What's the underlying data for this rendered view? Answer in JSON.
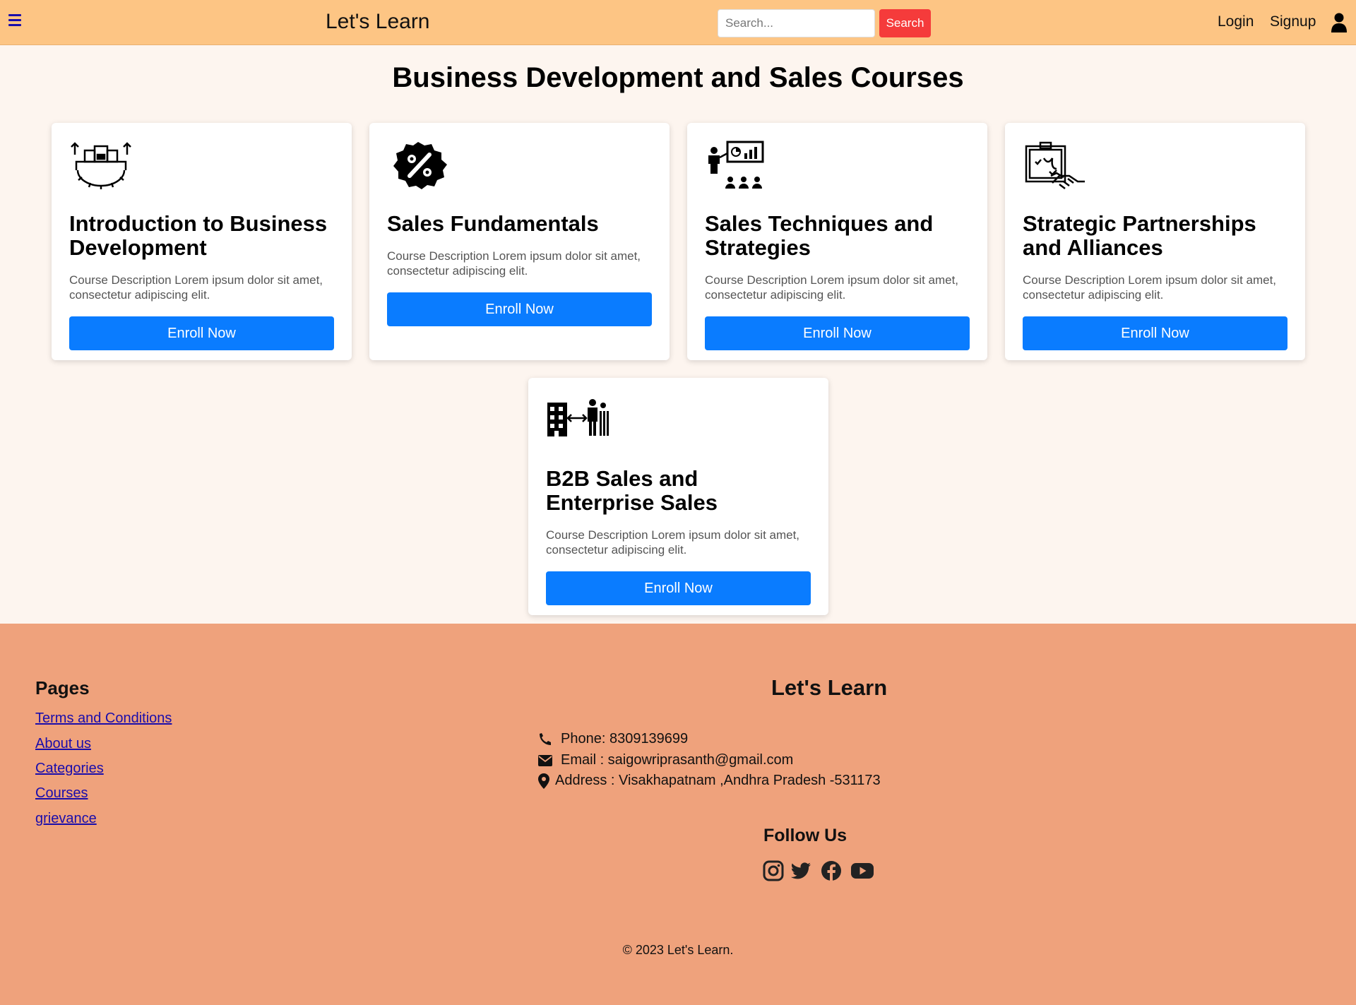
{
  "navbar": {
    "brand": "Let's Learn",
    "search_placeholder": "Search...",
    "search_button": "Search",
    "login": "Login",
    "signup": "Signup",
    "colors": {
      "background": "#fdc584",
      "search_button": "#f53b3b"
    }
  },
  "page": {
    "title": "Business Development and Sales Courses"
  },
  "courses": [
    {
      "title": "Introduction to Business Development",
      "description": "Course Description Lorem ipsum dolor sit amet, consectetur adipiscing elit.",
      "button": "Enroll Now",
      "icon": "business-gear-icon"
    },
    {
      "title": "Sales Fundamentals",
      "description": "Course Description Lorem ipsum dolor sit amet, consectetur adipiscing elit.",
      "button": "Enroll Now",
      "icon": "percent-badge-icon"
    },
    {
      "title": "Sales Techniques and Strategies",
      "description": "Course Description Lorem ipsum dolor sit amet, consectetur adipiscing elit.",
      "button": "Enroll Now",
      "icon": "presentation-icon"
    },
    {
      "title": "Strategic Partnerships and Alliances",
      "description": "Course Description Lorem ipsum dolor sit amet, consectetur adipiscing elit.",
      "button": "Enroll Now",
      "icon": "handshake-board-icon"
    },
    {
      "title": "B2B Sales and Enterprise Sales",
      "description": "Course Description Lorem ipsum dolor sit amet, consectetur adipiscing elit.",
      "button": "Enroll Now",
      "icon": "building-to-people-icon"
    }
  ],
  "footer": {
    "pages_heading": "Pages",
    "links": [
      "Terms and Conditions",
      "About us",
      "Categories",
      "Courses",
      "grievance"
    ],
    "brand": "Let's Learn",
    "phone": "Phone: 8309139699",
    "email": "Email : saigowriprasanth@gmail.com",
    "address": "Address : Visakhapatnam ,Andhra Pradesh -531173",
    "follow_heading": "Follow Us",
    "social": [
      "instagram-icon",
      "twitter-icon",
      "facebook-icon",
      "youtube-icon"
    ],
    "copyright": "© 2023 Let's Learn.",
    "colors": {
      "background": "#efa27c",
      "link": "#1a0dab"
    }
  },
  "colors": {
    "page_background": "#fdf5ef",
    "enroll_button": "#0a7cff"
  }
}
